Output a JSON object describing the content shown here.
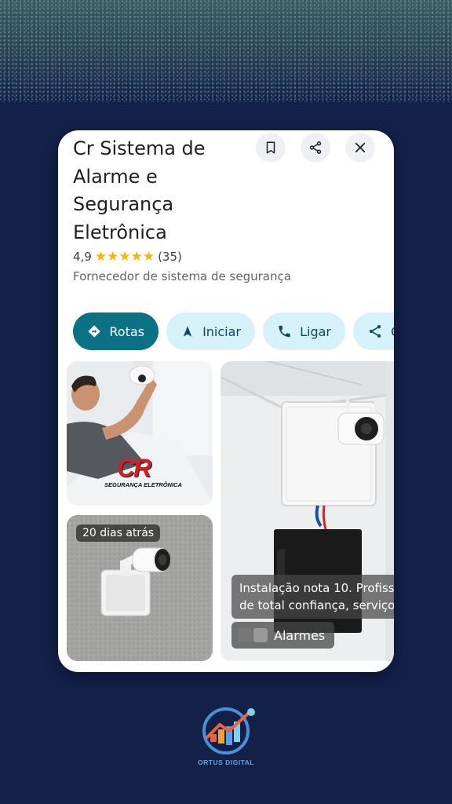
{
  "place": {
    "title": "Cr Sistema de Alarme e Segurança Eletrônica",
    "rating": "4,9",
    "stars": "★★★★★",
    "review_count": "(35)",
    "category": "Fornecedor de sistema de segurança"
  },
  "actions": {
    "routes": "Rotas",
    "start": "Iniciar",
    "call": "Ligar",
    "share": "C"
  },
  "icons": [
    "bookmark-icon",
    "share-icon",
    "close-icon",
    "directions-icon",
    "navigation-arrow-icon",
    "phone-icon",
    "share-icon"
  ],
  "photos": {
    "logo_letters": "CR",
    "logo_subtitle": "SEGURANÇA ELETRÔNICA",
    "time_badge": "20 dias atrás",
    "review_line1": "Instalação nota 10. Profiss",
    "review_line2": "de total confiança, serviço",
    "chip_label": "Alarmes"
  },
  "branding": {
    "name": "ORTUS DIGITAL"
  },
  "colors": {
    "background": "#132048",
    "primary_pill": "#0b7285",
    "secondary_pill": "#d7f1fa",
    "star": "#f7b500"
  }
}
